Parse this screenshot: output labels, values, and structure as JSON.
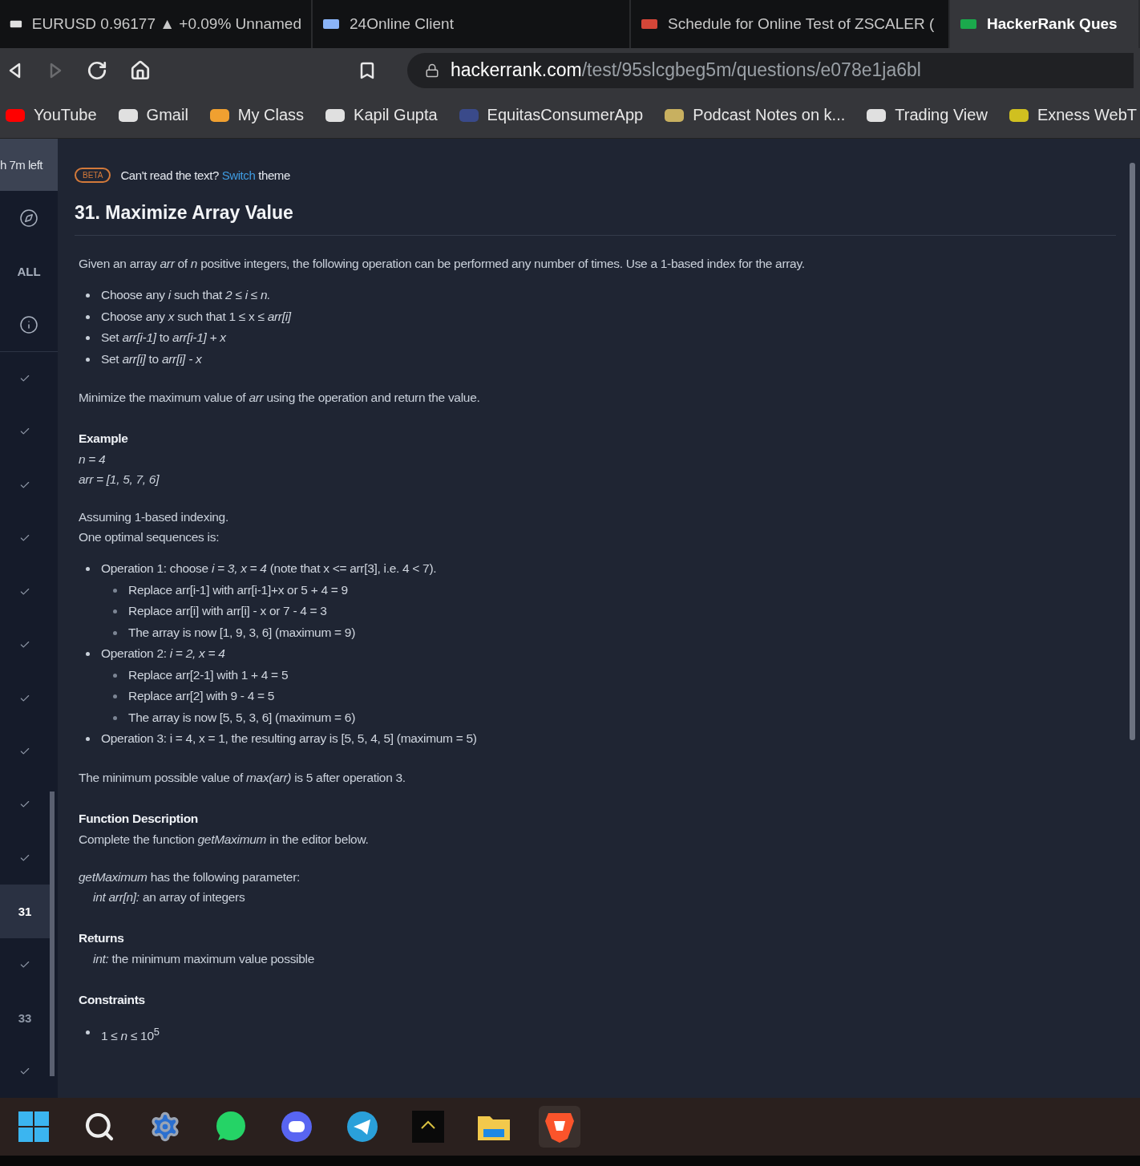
{
  "browser": {
    "tabs": [
      {
        "label": "EURUSD 0.96177 ▲ +0.09% Unnamed",
        "selected": false
      },
      {
        "label": "24Online Client",
        "selected": false
      },
      {
        "label": "Schedule for Online Test of ZSCALER (",
        "selected": false
      },
      {
        "label": "HackerRank Ques",
        "selected": true
      }
    ],
    "url": {
      "domain": "hackerrank.com",
      "path": "/test/95slcgbeg5m/questions/e078e1ja6bl"
    },
    "bookmarks": [
      {
        "label": "YouTube"
      },
      {
        "label": "Gmail"
      },
      {
        "label": "My Class"
      },
      {
        "label": "Kapil Gupta"
      },
      {
        "label": "EquitasConsumerApp"
      },
      {
        "label": "Podcast Notes on k..."
      },
      {
        "label": "Trading View"
      },
      {
        "label": "Exness WebT"
      }
    ]
  },
  "sidebar": {
    "timer": "h 7m left",
    "filter_label": "ALL",
    "questions": [
      {
        "kind": "done",
        "selected": false
      },
      {
        "kind": "done",
        "selected": false
      },
      {
        "kind": "done",
        "selected": false
      },
      {
        "kind": "done",
        "selected": false
      },
      {
        "kind": "done",
        "selected": false
      },
      {
        "kind": "done",
        "selected": false
      },
      {
        "kind": "done",
        "selected": false
      },
      {
        "kind": "done",
        "selected": false
      },
      {
        "kind": "done",
        "selected": false
      },
      {
        "kind": "done",
        "selected": false
      },
      {
        "kind": "number",
        "label": "31",
        "selected": true
      },
      {
        "kind": "done",
        "selected": false
      },
      {
        "kind": "number",
        "label": "33",
        "selected": false
      },
      {
        "kind": "done",
        "selected": false
      }
    ]
  },
  "problem": {
    "badge": "BETA",
    "notice": "Can't read the text?",
    "notice_link": "Switch",
    "notice_after": "theme",
    "title": "31. Maximize Array Value",
    "blocks": [
      {
        "kind": "paragraph",
        "lines": [
          {
            "text": "Given an array *arr* of *n* positive integers, the following operation can be performed any number of times. Use a 1-based index for the array.",
            "indent": false
          }
        ]
      },
      {
        "kind": "list",
        "items": [
          {
            "text": "Choose any *i* such that *2 ≤ i ≤ n.*"
          },
          {
            "text": "Choose any *x* such that 1 ≤ x ≤ *arr[i]*"
          },
          {
            "text": "Set *arr[i-1]* to *arr[i-1] + x*"
          },
          {
            "text": "Set *arr[i]* to *arr[i] - x*"
          }
        ]
      },
      {
        "kind": "paragraph",
        "lines": [
          {
            "text": "Minimize the maximum value of *arr* using the operation and return the value.",
            "indent": false
          }
        ]
      },
      {
        "kind": "heading",
        "text": "Example"
      },
      {
        "kind": "paragraph",
        "lines": [
          {
            "text": "*n = 4*",
            "indent": false
          },
          {
            "text": "*arr = [1, 5, 7, 6]*",
            "indent": false
          }
        ]
      },
      {
        "kind": "paragraph",
        "lines": [
          {
            "text": "Assuming 1-based indexing.",
            "indent": false
          },
          {
            "text": "One optimal sequences is:",
            "indent": false
          }
        ]
      },
      {
        "kind": "list",
        "items": [
          {
            "text": "Operation 1: choose *i = 3, x = 4* (note that x <= arr[3], i.e. 4 < 7).",
            "children": [
              {
                "text": "Replace arr[i-1] with arr[i-1]+x or 5 + 4 = 9"
              },
              {
                "text": "Replace arr[i] with arr[i] - x or 7 - 4 = 3"
              },
              {
                "text": "The array is now [1, 9, 3, 6] (maximum = 9)"
              }
            ]
          },
          {
            "text": "Operation 2: *i = 2, x = 4*",
            "children": [
              {
                "text": "Replace arr[2-1] with 1 + 4 = 5"
              },
              {
                "text": "Replace arr[2] with 9 - 4 = 5"
              },
              {
                "text": "The array is now [5, 5, 3, 6] (maximum = 6)"
              }
            ]
          },
          {
            "text": "Operation 3: i = 4, x = 1, the resulting array is [5, 5, 4, 5] (maximum = 5)"
          }
        ]
      },
      {
        "kind": "paragraph",
        "lines": [
          {
            "text": "The minimum possible value of *max(arr)* is 5 after operation 3.",
            "indent": false
          }
        ]
      },
      {
        "kind": "heading",
        "text": "Function Description"
      },
      {
        "kind": "paragraph",
        "lines": [
          {
            "text": "Complete the function *getMaximum* in the editor below.",
            "indent": false
          }
        ]
      },
      {
        "kind": "paragraph",
        "lines": [
          {
            "text": "*getMaximum* has the following parameter:",
            "indent": false
          },
          {
            "text": "*int arr[n]:* an array of integers",
            "indent": true
          }
        ]
      },
      {
        "kind": "heading",
        "text": "Returns"
      },
      {
        "kind": "paragraph",
        "lines": [
          {
            "text": "*int:* the minimum maximum value possible",
            "indent": true
          }
        ]
      },
      {
        "kind": "heading",
        "text": "Constraints"
      },
      {
        "kind": "list",
        "items": [
          {
            "text": "1 ≤ *n* ≤ 10$^{5}$"
          }
        ]
      }
    ]
  }
}
